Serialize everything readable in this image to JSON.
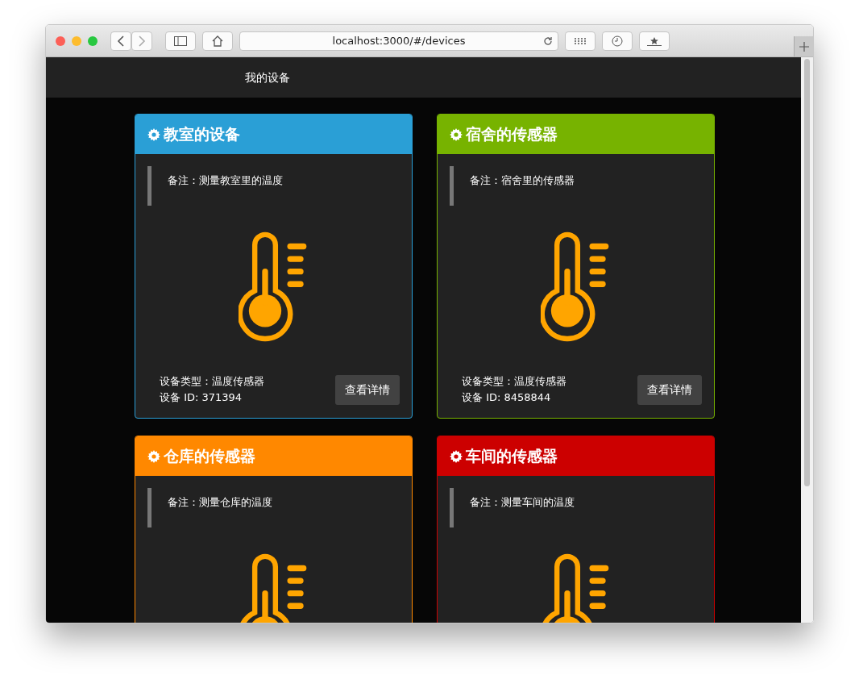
{
  "browser": {
    "address": "localhost:3000/#/devices"
  },
  "navbar": {
    "items": [
      {
        "label": "我的设备"
      }
    ]
  },
  "devices": [
    {
      "title": "教室的设备",
      "color": "#2a9fd6",
      "note": "备注：测量教室里的温度",
      "type_line": "设备类型：温度传感器",
      "id_line": "设备 ID: 371394",
      "button": "查看详情"
    },
    {
      "title": "宿舍的传感器",
      "color": "#77b300",
      "note": "备注：宿舍里的传感器",
      "type_line": "设备类型：温度传感器",
      "id_line": "设备 ID: 8458844",
      "button": "查看详情"
    },
    {
      "title": "仓库的传感器",
      "color": "#ff8800",
      "note": "备注：测量仓库的温度"
    },
    {
      "title": "车间的传感器",
      "color": "#cc0000",
      "note": "备注：测量车间的温度"
    }
  ]
}
